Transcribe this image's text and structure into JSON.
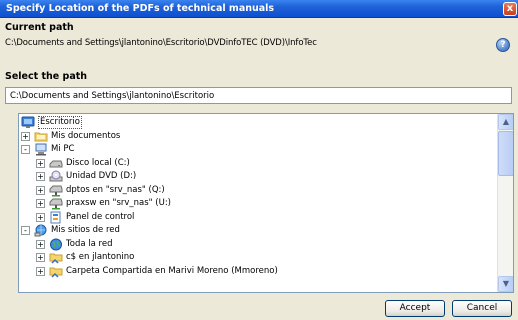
{
  "window": {
    "title": "Specify Location of the PDFs of technical manuals",
    "close_glyph": "x"
  },
  "current_path": {
    "label": "Current path",
    "value": "C:\\Documents and Settings\\jlantonino\\Escritorio\\DVDinfoTEC (DVD)\\InfoTec"
  },
  "select_path": {
    "label": "Select the path",
    "value": "C:\\Documents and Settings\\jlantonino\\Escritorio"
  },
  "help": {
    "icon": "help-icon",
    "glyph": "?"
  },
  "tree": {
    "items": [
      {
        "label": "Escritorio",
        "icon": "desktop-icon",
        "expander": "",
        "depth": 0
      },
      {
        "label": "Mis documentos",
        "icon": "folder-icon",
        "expander": "+",
        "depth": 1
      },
      {
        "label": "Mi PC",
        "icon": "computer-icon",
        "expander": "-",
        "depth": 1
      },
      {
        "label": "Disco local (C:)",
        "icon": "hard-drive-icon",
        "expander": "+",
        "depth": 2
      },
      {
        "label": "Unidad DVD (D:)",
        "icon": "dvd-drive-icon",
        "expander": "+",
        "depth": 2
      },
      {
        "label": "dptos en \"srv_nas\" (Q:)",
        "icon": "network-drive-icon",
        "expander": "+",
        "depth": 2
      },
      {
        "label": "praxsw en \"srv_nas\" (U:)",
        "icon": "network-drive-icon",
        "expander": "+",
        "depth": 2
      },
      {
        "label": "Panel de control",
        "icon": "control-panel-icon",
        "expander": "+",
        "depth": 2
      },
      {
        "label": "Mis sitios de red",
        "icon": "network-places-icon",
        "expander": "-",
        "depth": 1
      },
      {
        "label": "Toda la red",
        "icon": "globe-icon",
        "expander": "+",
        "depth": 2
      },
      {
        "label": "c$ en jlantonino",
        "icon": "shared-folder-icon",
        "expander": "+",
        "depth": 2
      },
      {
        "label": "Carpeta Compartida en Marivi Moreno (Mmoreno)",
        "icon": "shared-folder-icon",
        "expander": "+",
        "depth": 2
      }
    ],
    "scroll_up": "▲",
    "scroll_down": "▼"
  },
  "buttons": {
    "accept": "Accept",
    "cancel": "Cancel"
  },
  "colors": {
    "titlebar": "#0d4fd0",
    "dialog_bg": "#ece9d8",
    "input_border": "#7f9db9"
  }
}
